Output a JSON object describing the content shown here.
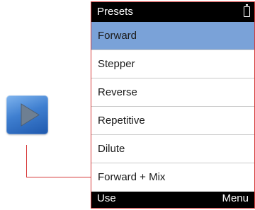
{
  "header": {
    "title": "Presets"
  },
  "menu": {
    "items": [
      {
        "label": "Forward",
        "selected": true
      },
      {
        "label": "Stepper",
        "selected": false
      },
      {
        "label": "Reverse",
        "selected": false
      },
      {
        "label": "Repetitive",
        "selected": false
      },
      {
        "label": "Dilute",
        "selected": false
      },
      {
        "label": "Forward + Mix",
        "selected": false
      }
    ]
  },
  "softkeys": {
    "left": "Use",
    "right": "Menu"
  },
  "icons": {
    "play": "play-icon",
    "battery": "battery-icon"
  },
  "colors": {
    "selected_row": "#7aa2d8",
    "callout_line": "#d73b3b",
    "play_tile": "#3f7fd0"
  }
}
